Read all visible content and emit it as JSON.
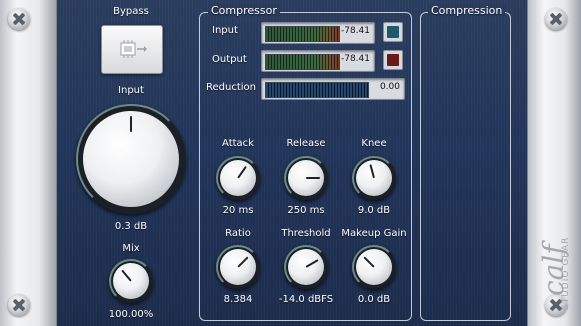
{
  "plugin": {
    "brand_text": "calf",
    "brand_subtext": "STUDIO GEAR"
  },
  "bypass": {
    "label": "Bypass",
    "icon": "chip-bypass-icon"
  },
  "input": {
    "label": "Input",
    "value": "0.3 dB"
  },
  "mix": {
    "label": "Mix",
    "value": "100.00%"
  },
  "compressor": {
    "title": "Compressor",
    "meters": [
      {
        "label": "Input",
        "value": "-78.41",
        "led_color": "#1b5a6a"
      },
      {
        "label": "Output",
        "value": "-78.41",
        "led_color": "#6a1818"
      },
      {
        "label": "Reduction",
        "value": "0.00"
      }
    ],
    "knobs": [
      {
        "label": "Attack",
        "value": "20 ms"
      },
      {
        "label": "Release",
        "value": "250 ms"
      },
      {
        "label": "Knee",
        "value": "9.0 dB"
      },
      {
        "label": "Ratio",
        "value": "8.384"
      },
      {
        "label": "Threshold",
        "value": "-14.0 dBFS"
      },
      {
        "label": "Makeup Gain",
        "value": "0.0 dB"
      }
    ]
  },
  "compression": {
    "title": "Compression"
  }
}
